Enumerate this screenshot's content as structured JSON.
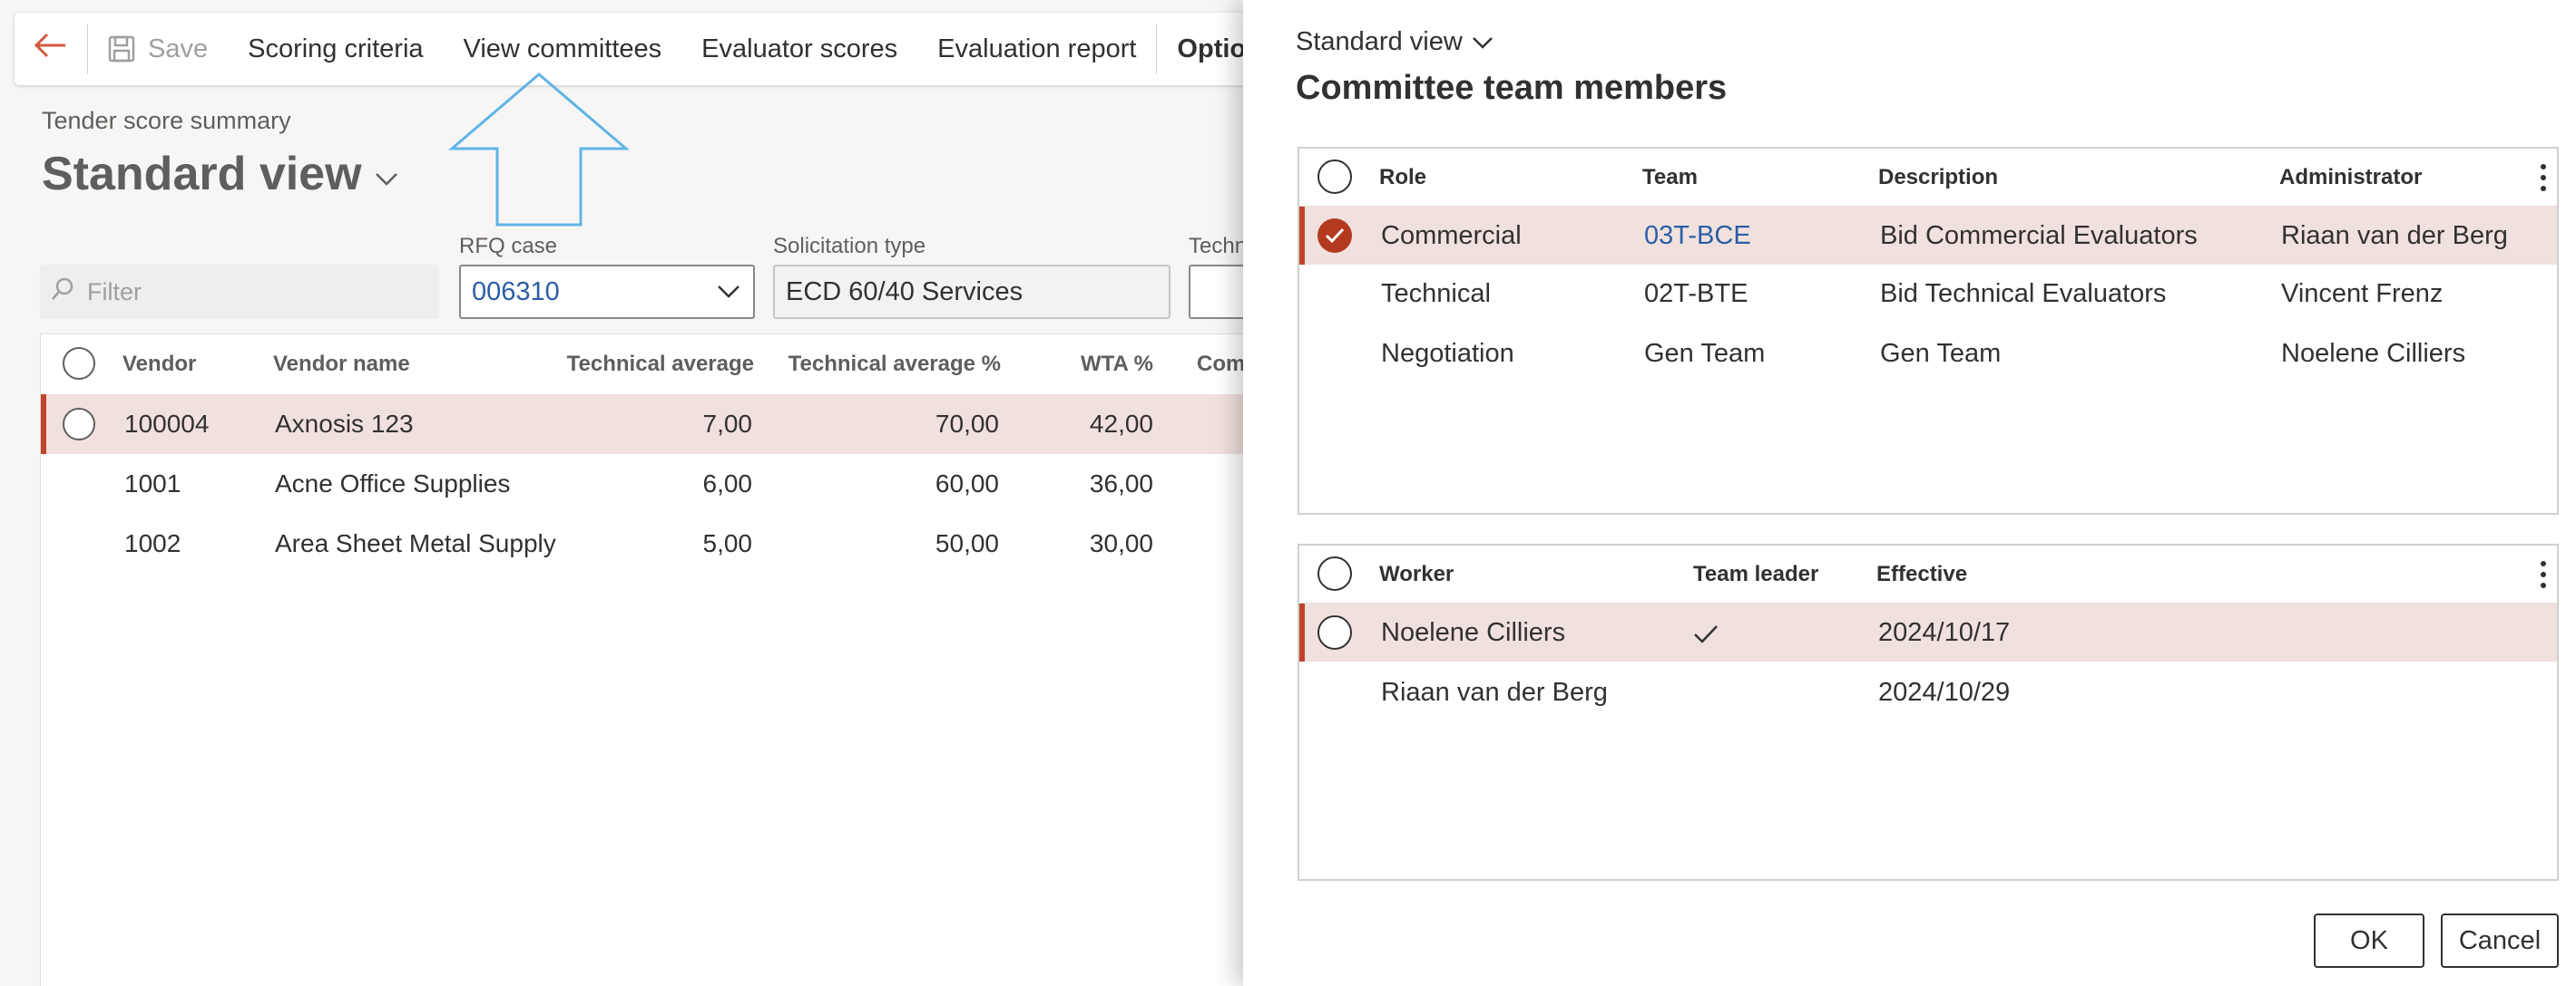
{
  "toolbar": {
    "save_label": "Save",
    "items": [
      "Scoring criteria",
      "View committees",
      "Evaluator scores",
      "Evaluation report",
      "Options"
    ]
  },
  "summary": {
    "caption": "Tender score summary",
    "view_title": "Standard view",
    "filter_placeholder": "Filter",
    "rfq_label": "RFQ case",
    "rfq_value": "006310",
    "solicitation_label": "Solicitation type",
    "solicitation_value": "ECD 60/40 Services",
    "technical_label": "Techn"
  },
  "vendor_grid": {
    "columns": [
      "Vendor",
      "Vendor name",
      "Technical average",
      "Technical average %",
      "WTA %",
      "Com"
    ],
    "rows": [
      {
        "vendor": "100004",
        "name": "Axnosis 123",
        "tech_avg": "7,00",
        "tech_avg_pct": "70,00",
        "wta": "42,00",
        "selected": true
      },
      {
        "vendor": "1001",
        "name": "Acne Office Supplies",
        "tech_avg": "6,00",
        "tech_avg_pct": "60,00",
        "wta": "36,00",
        "selected": false
      },
      {
        "vendor": "1002",
        "name": "Area Sheet Metal Supply",
        "tech_avg": "5,00",
        "tech_avg_pct": "50,00",
        "wta": "30,00",
        "selected": false
      }
    ]
  },
  "dialog": {
    "view_label": "Standard view",
    "title": "Committee team members",
    "committee_grid": {
      "columns": [
        "Role",
        "Team",
        "Description",
        "Administrator"
      ],
      "rows": [
        {
          "role": "Commercial",
          "team": "03T-BCE",
          "description": "Bid Commercial Evaluators",
          "administrator": "Riaan van der Berg",
          "selected": true
        },
        {
          "role": "Technical",
          "team": "02T-BTE",
          "description": "Bid Technical Evaluators",
          "administrator": "Vincent Frenz",
          "selected": false
        },
        {
          "role": "Negotiation",
          "team": "Gen Team",
          "description": "Gen Team",
          "administrator": "Noelene Cilliers",
          "selected": false
        }
      ]
    },
    "worker_grid": {
      "columns": [
        "Worker",
        "Team leader",
        "Effective"
      ],
      "rows": [
        {
          "worker": "Noelene Cilliers",
          "team_leader": true,
          "effective": "2024/10/17",
          "selected": true
        },
        {
          "worker": "Riaan van der Berg",
          "team_leader": false,
          "effective": "2024/10/29",
          "selected": false
        }
      ]
    },
    "ok_label": "OK",
    "cancel_label": "Cancel"
  },
  "colors": {
    "selected_row": "#f1e1de",
    "accent": "#c0442b",
    "link": "#2b5ea7",
    "callout_arrow": "#5fb4e6"
  },
  "icons": [
    "back-arrow-icon",
    "save-icon",
    "chevron-down-icon",
    "search-icon",
    "more-options-icon",
    "checkmark-icon"
  ]
}
